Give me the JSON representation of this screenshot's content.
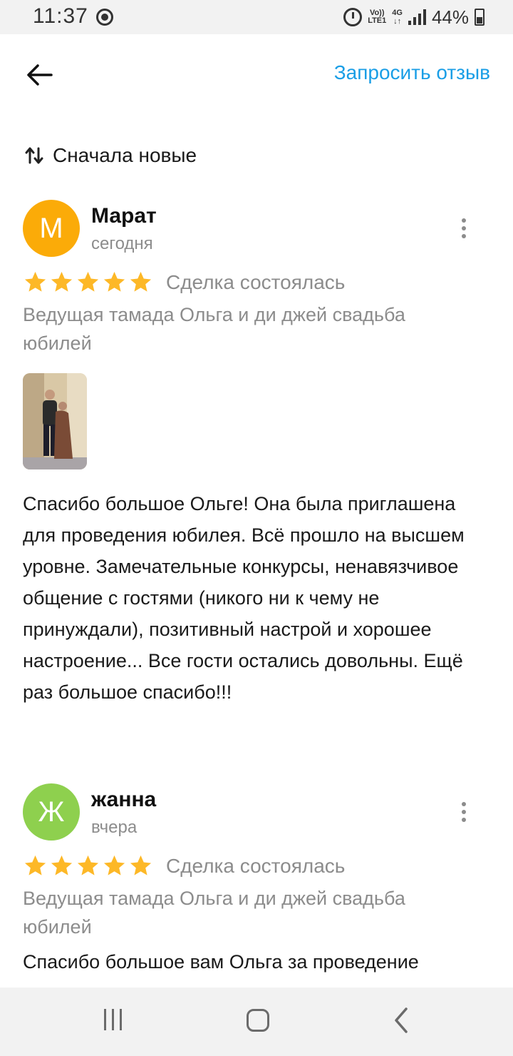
{
  "status_bar": {
    "time": "11:37",
    "volte_top": "Vo))",
    "volte_bottom": "LTE1",
    "network": "4G",
    "battery": "44%"
  },
  "header": {
    "request_review": "Запросить отзыв"
  },
  "sort": {
    "label": "Сначала новые"
  },
  "colors": {
    "accent_link": "#1a9ee6",
    "star": "#fdb827",
    "avatar_m": "#fbab08",
    "avatar_zh": "#8ed04e"
  },
  "reviews": [
    {
      "avatar_letter": "М",
      "author": "Марат",
      "date": "сегодня",
      "rating": 5,
      "status": "Сделка состоялась",
      "service": "Ведущая тамада Ольга и ди джей свадьба юбилей",
      "text": "Спасибо большое Ольге! Она была приглашена для проведения юбилея. Всё прошло на высшем уровне. Замечательные конкурсы, ненавязчивое общение с гостями (никого ни к чему не принуждали), позитивный настрой и хорошее настроение... Все гости остались довольны. Ещё раз большое спасибо!!!"
    },
    {
      "avatar_letter": "Ж",
      "author": "жанна",
      "date": "вчера",
      "rating": 5,
      "status": "Сделка состоялась",
      "service": "Ведущая тамада Ольга и ди джей свадьба юбилей",
      "text": "Спасибо большое вам Ольга за проведение"
    }
  ]
}
